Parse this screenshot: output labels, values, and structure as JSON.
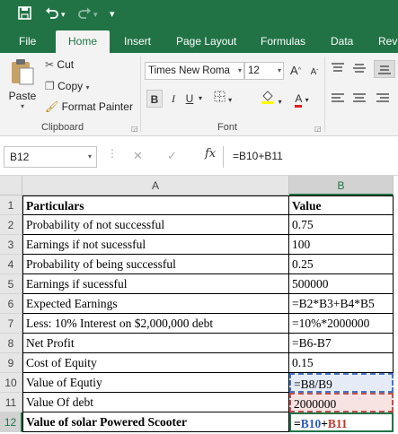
{
  "app": {
    "accent": "#217346"
  },
  "qat": {
    "save_icon": "save-icon",
    "undo_icon": "undo-icon",
    "redo_icon": "redo-icon",
    "customize_icon": "customize-qat-icon"
  },
  "tabs": [
    {
      "label": "File"
    },
    {
      "label": "Home"
    },
    {
      "label": "Insert"
    },
    {
      "label": "Page Layout"
    },
    {
      "label": "Formulas"
    },
    {
      "label": "Data"
    },
    {
      "label": "Revi"
    }
  ],
  "ribbon": {
    "clipboard": {
      "paste_label": "Paste",
      "cut_label": "Cut",
      "copy_label": "Copy",
      "format_painter_label": "Format Painter",
      "group_label": "Clipboard"
    },
    "font": {
      "font_name": "Times New Roma",
      "font_size": "12",
      "grow_label": "A",
      "shrink_label": "A",
      "bold_label": "B",
      "italic_label": "I",
      "underline_label": "U",
      "font_color_label": "A",
      "group_label": "Font"
    }
  },
  "formula_bar": {
    "name_box": "B12",
    "fx_label": "fx",
    "formula": "=B10+B11"
  },
  "sheet": {
    "columns": [
      "A",
      "B"
    ],
    "rows": [
      {
        "num": "1",
        "a": "Particulars",
        "b": "Value",
        "bold": true
      },
      {
        "num": "2",
        "a": "Probability of not successful",
        "b": "0.75"
      },
      {
        "num": "3",
        "a": "Earnings if not sucessful",
        "b": "100"
      },
      {
        "num": "4",
        "a": "Probability of being successful",
        "b": "0.25"
      },
      {
        "num": "5",
        "a": "Earnings if sucessful",
        "b": "500000"
      },
      {
        "num": "6",
        "a": "Expected Earnings",
        "b": "=B2*B3+B4*B5"
      },
      {
        "num": "7",
        "a": "Less: 10% Interest on $2,000,000 debt",
        "b": "=10%*2000000"
      },
      {
        "num": "8",
        "a": "Net Profit",
        "b": "=B6-B7"
      },
      {
        "num": "9",
        "a": "Cost of Equity",
        "b": "0.15"
      },
      {
        "num": "10",
        "a": "Value of Equtiy",
        "b": "=B8/B9"
      },
      {
        "num": "11",
        "a": "Value Of debt",
        "b": "2000000"
      },
      {
        "num": "12",
        "a": "Value of solar Powered Scooter",
        "b": ""
      }
    ],
    "edit_cell": {
      "eq": "=",
      "ref1": "B10",
      "plus": "+",
      "ref2": "B11"
    }
  }
}
